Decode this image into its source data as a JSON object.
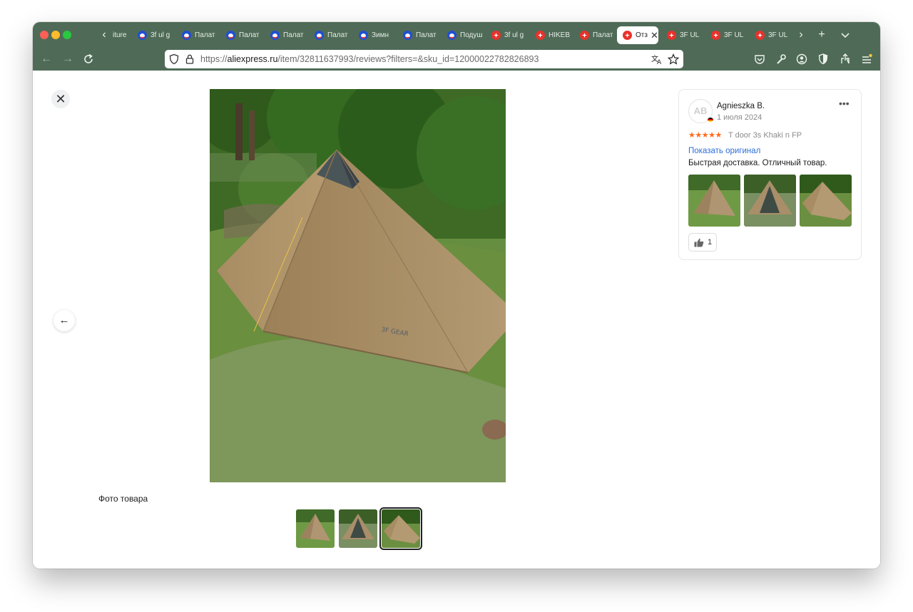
{
  "browser": {
    "tabs": [
      {
        "label": "iture",
        "favicon": "chevron-left-icon"
      },
      {
        "label": "3f ul g",
        "favicon": "blue-circle-favicon"
      },
      {
        "label": "Палат",
        "favicon": "blue-circle-favicon"
      },
      {
        "label": "Палат",
        "favicon": "blue-circle-favicon"
      },
      {
        "label": "Палат",
        "favicon": "blue-circle-favicon"
      },
      {
        "label": "Палат",
        "favicon": "blue-circle-favicon"
      },
      {
        "label": "Зимн",
        "favicon": "blue-circle-favicon"
      },
      {
        "label": "Палат",
        "favicon": "blue-circle-favicon"
      },
      {
        "label": "Подуш",
        "favicon": "blue-circle-favicon"
      },
      {
        "label": "3f ul g",
        "favicon": "aliexpress-favicon"
      },
      {
        "label": "HIKEB",
        "favicon": "aliexpress-favicon"
      },
      {
        "label": "Палат",
        "favicon": "aliexpress-favicon"
      },
      {
        "label": "Отз",
        "favicon": "aliexpress-favicon",
        "active": true
      },
      {
        "label": "3F UL",
        "favicon": "aliexpress-favicon"
      },
      {
        "label": "3F UL",
        "favicon": "aliexpress-favicon"
      },
      {
        "label": "3F UL",
        "favicon": "aliexpress-favicon"
      }
    ],
    "url_prefix": "https://",
    "url_domain": "aliexpress.ru",
    "url_path": "/item/32811637993/reviews?filters=&sku_id=12000022782826893",
    "theme_color": "#4f6b57"
  },
  "viewer": {
    "caption": "Фото товара",
    "selected_index": 3,
    "thumbnails": [
      "photo-1",
      "photo-2",
      "photo-3"
    ]
  },
  "review": {
    "avatar_initials": "AB",
    "author": "Agnieszka B.",
    "date": "1 июля 2024",
    "rating": 5,
    "stars": "★★★★★",
    "sku": "T door 3s Khaki n FP",
    "show_original": "Показать оригинал",
    "text": "Быстрая доставка. Отличный товар.",
    "likes": "1",
    "accent_color": "#ff6a1a",
    "link_color": "#2f6fd6"
  }
}
